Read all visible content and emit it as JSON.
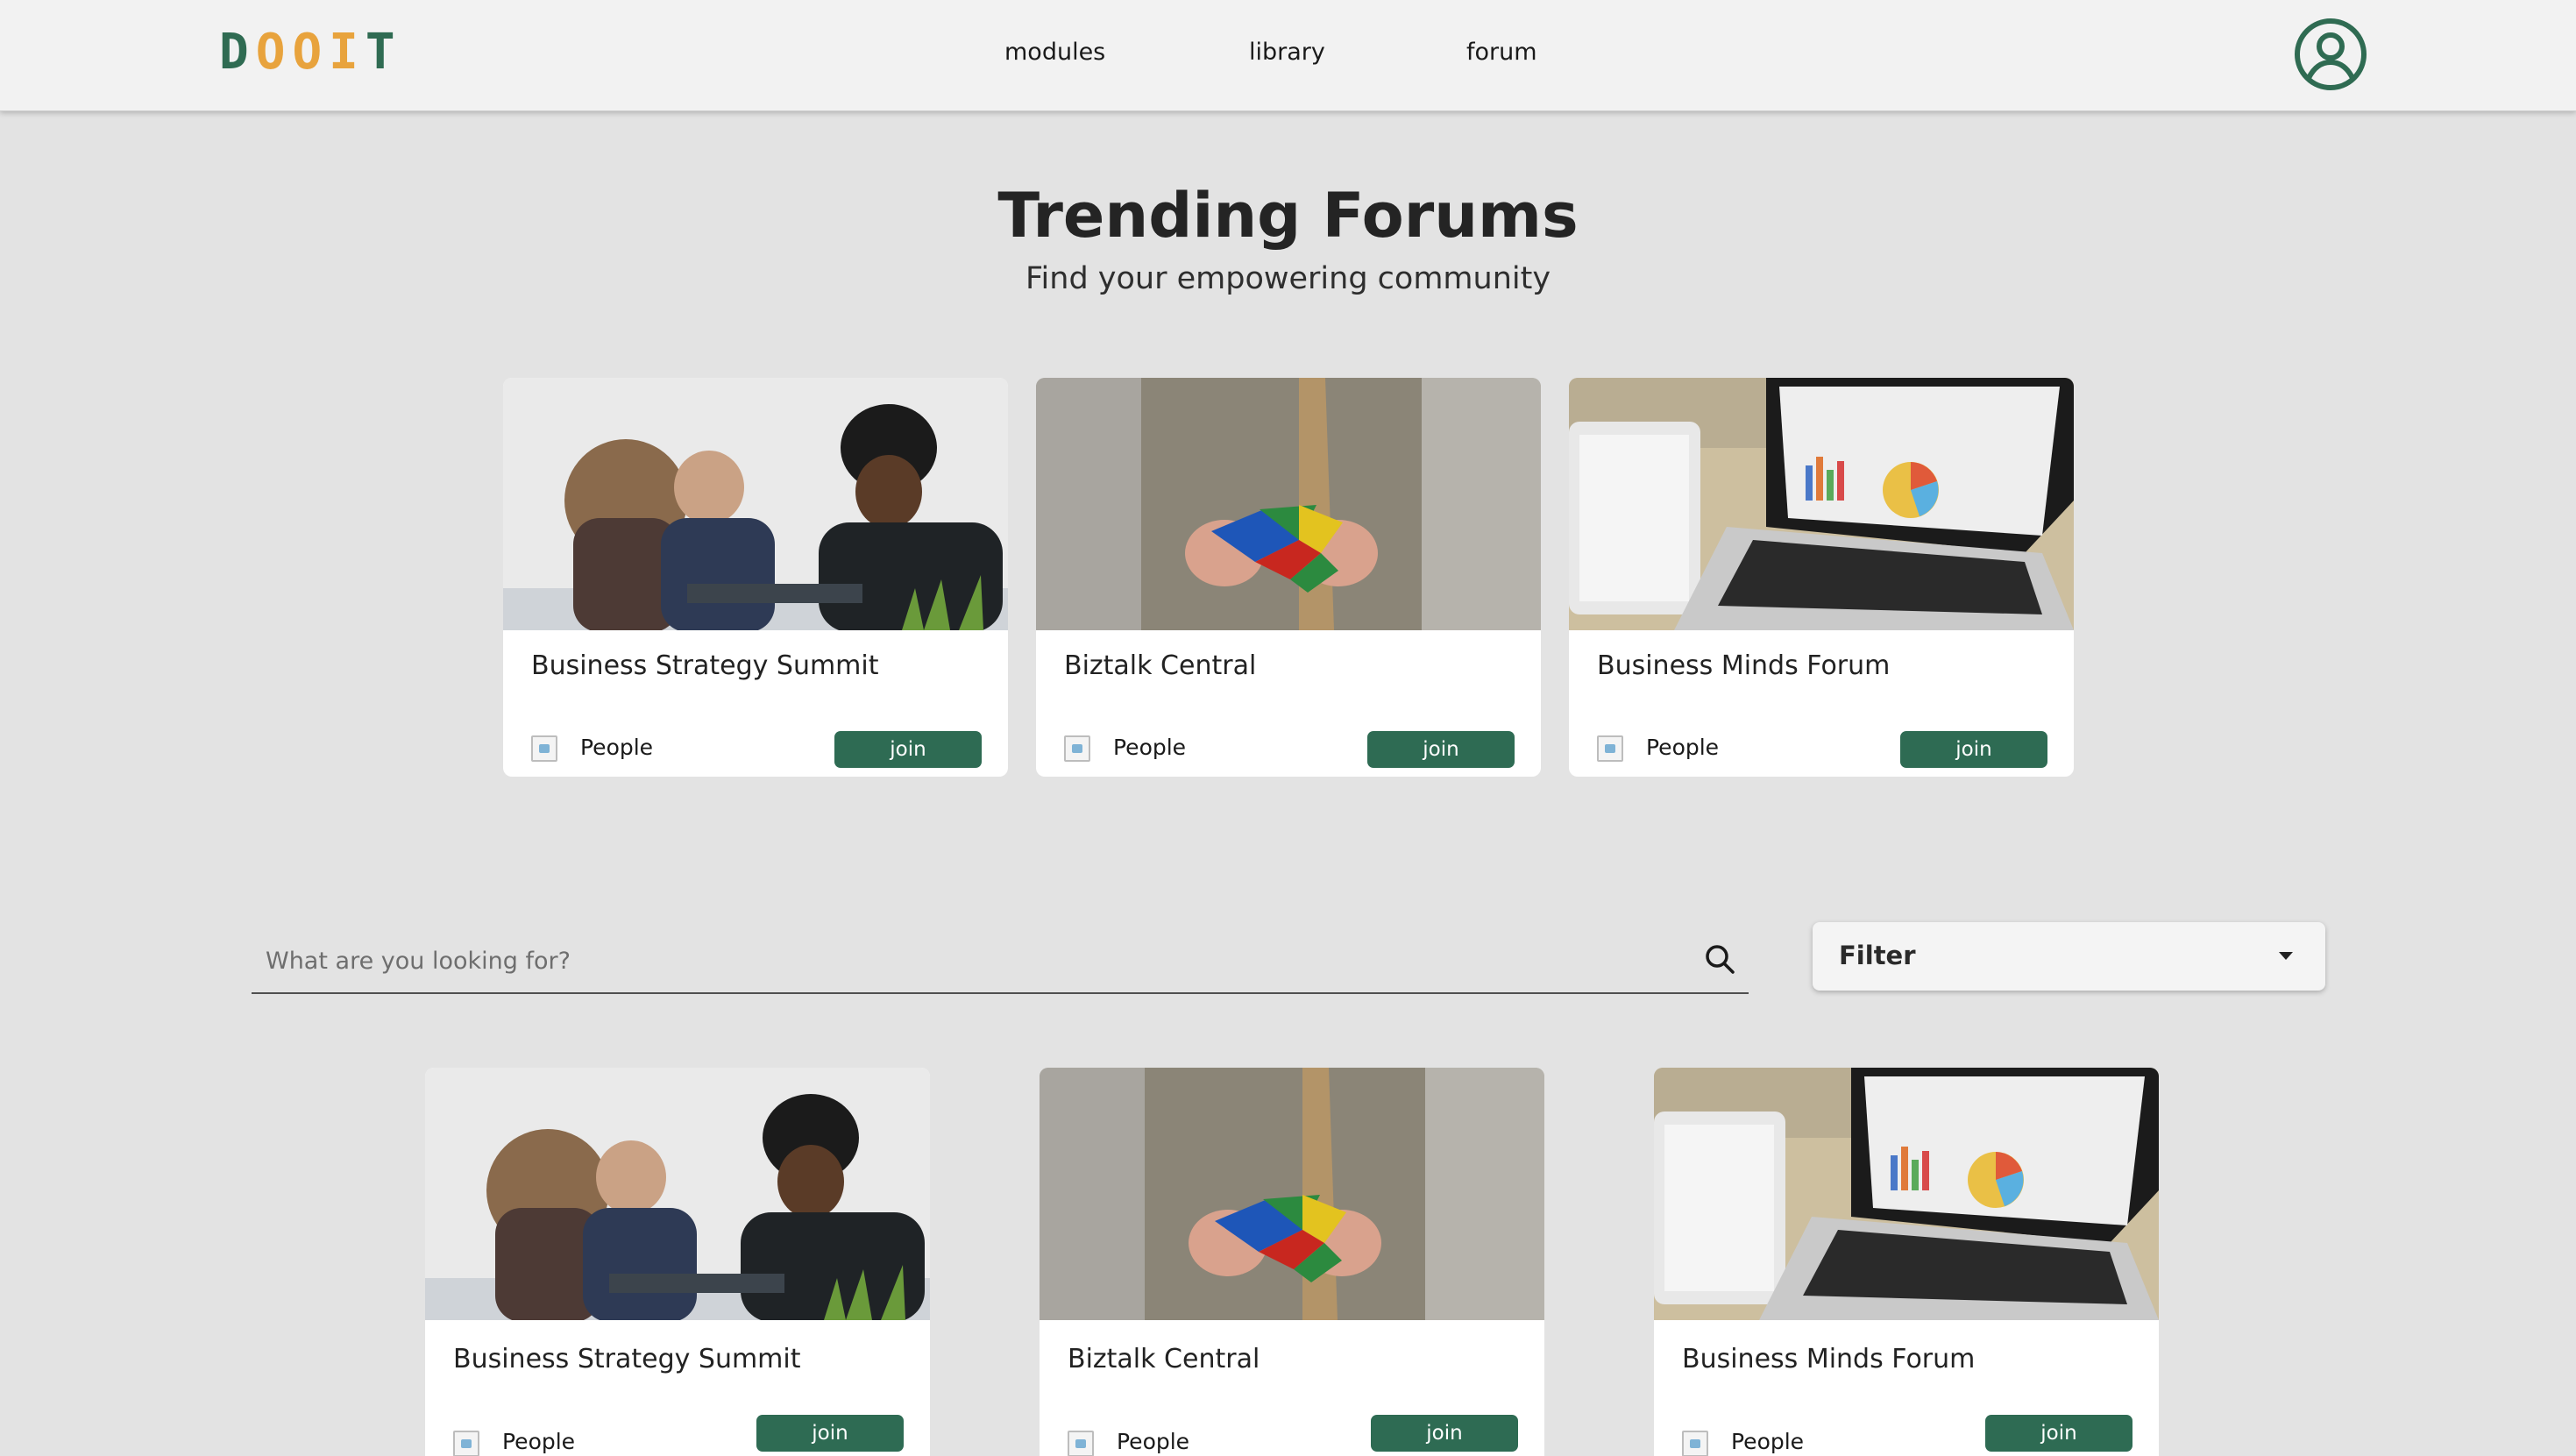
{
  "app": {
    "logo_letters": [
      "D",
      "O",
      "O",
      "I",
      "T"
    ],
    "brand_colors": {
      "green": "#2f6b52",
      "orange": "#e8a33d"
    }
  },
  "nav": {
    "links": [
      "modules",
      "library",
      "forum"
    ],
    "profile_icon": "user-circle-icon"
  },
  "hero": {
    "title": "Trending Forums",
    "subtitle": "Find your empowering community"
  },
  "trending": [
    {
      "title": "Business Strategy Summit",
      "people_label": "People",
      "join_label": "join",
      "image": "team-meeting-photo"
    },
    {
      "title": "Biztalk Central",
      "people_label": "People",
      "join_label": "join",
      "image": "puzzle-cube-photo"
    },
    {
      "title": "Business Minds Forum",
      "people_label": "People",
      "join_label": "join",
      "image": "laptop-chart-photo"
    }
  ],
  "search": {
    "placeholder": "What are you looking for?",
    "icon": "search-icon"
  },
  "filter": {
    "label": "Filter",
    "icon": "caret-down-icon"
  },
  "forums": [
    {
      "title": "Business Strategy Summit",
      "people_label": "People",
      "join_label": "join",
      "image": "team-meeting-photo"
    },
    {
      "title": "Biztalk Central",
      "people_label": "People",
      "join_label": "join",
      "image": "puzzle-cube-photo"
    },
    {
      "title": "Business Minds Forum",
      "people_label": "People",
      "join_label": "join",
      "image": "laptop-chart-photo"
    }
  ],
  "colors": {
    "accent": "#2e6b53",
    "background": "#e3e3e3",
    "navbar": "#f2f2f2"
  }
}
